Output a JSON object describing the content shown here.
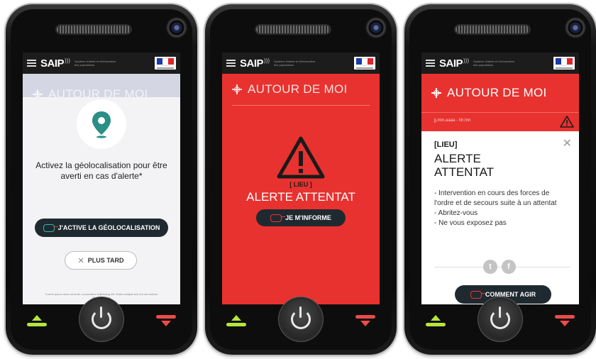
{
  "app": {
    "logo": "SAIP",
    "logo_waves": ")))",
    "logo_subtitle": "Système d'alerte et d'information des populations",
    "section_title": "AUTOUR DE MOI"
  },
  "screen1": {
    "message": "Activez la géolocalisation pour être averti en cas d'alerte*",
    "primary_button": "J'ACTIVE LA GÉOLOCALISATION",
    "secondary_button": "PLUS TARD",
    "footnote": "*Lorem ipsum dolor sit amet, consectetur adipiscing elit. Nulla volutpat sed dui nec lacinia. En savoir plus"
  },
  "screen2": {
    "location": "[ LIEU ]",
    "alert_title": "ALERTE ATTENTAT",
    "button": "JE M'INFORME"
  },
  "screen3": {
    "datetime": "jj.mm.aaaa - hh:mn",
    "location": "[LIEU]",
    "alert_title": "ALERTE ATTENTAT",
    "instructions": [
      "- Intervention en cours des forces de l'ordre et de secours suite à un attentat",
      "- Abritez-vous",
      "- Ne vous exposez pas"
    ],
    "button": "COMMENT AGIR",
    "close_glyph": "✕",
    "twitter_glyph": "t",
    "facebook_glyph": "f"
  },
  "colors": {
    "alert_red": "#e8322f",
    "teal": "#2a8f85",
    "dark": "#1c1c1c",
    "answer_green": "#b7e53b",
    "hangup_red": "#ee4b4b"
  }
}
